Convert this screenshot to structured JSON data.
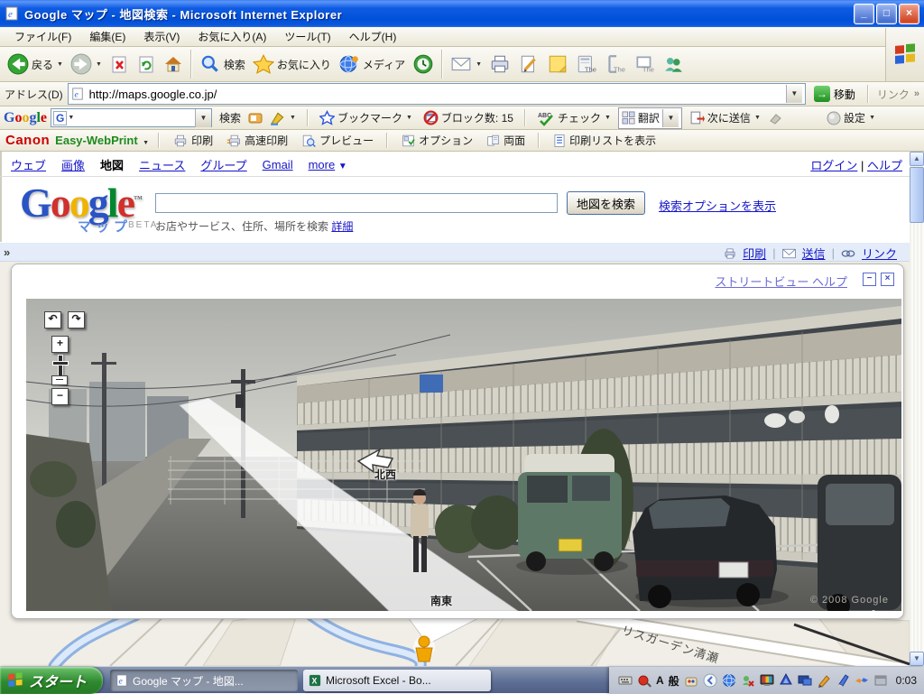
{
  "glyphs": {
    "down": "▼",
    "chevron": "»",
    "sep": "|",
    "tm": "™",
    "min": "_",
    "max": "□",
    "close": "×",
    "back": "←",
    "fwd": "→",
    "plus": "+",
    "minus": "−",
    "rot_l": "↶",
    "rot_r": "↷",
    "panel_min": "−",
    "panel_close": "×",
    "up": "▲",
    "lt": "<",
    "check": "✓",
    "e": "e",
    "x": "X",
    "g": "G"
  },
  "titlebar": {
    "title": "Google マップ - 地図検索 - Microsoft Internet Explorer"
  },
  "menubar": {
    "items": [
      "ファイル(F)",
      "編集(E)",
      "表示(V)",
      "お気に入り(A)",
      "ツール(T)",
      "ヘルプ(H)"
    ]
  },
  "toolbar": {
    "back": "戻る",
    "search": "検索",
    "favorites": "お気に入り",
    "media": "メディア",
    "the": "The"
  },
  "addressbar": {
    "label": "アドレス(D)",
    "url": "http://maps.google.co.jp/",
    "go": "移動",
    "links": "リンク"
  },
  "gtoolbar": {
    "logo_letters": [
      "G",
      "o",
      "o",
      "g",
      "l",
      "e"
    ],
    "search": "検索",
    "bookmarks": "ブックマーク",
    "blocked": "ブロック数: 15",
    "check_abc": "ABC",
    "check": "チェック",
    "translate": "翻訳",
    "send": "次に送信",
    "settings": "設定"
  },
  "canonbar": {
    "brand": "Canon",
    "product": "Easy-WebPrint",
    "print": "印刷",
    "fast_print": "高速印刷",
    "preview": "プレビュー",
    "options": "オプション",
    "duplex": "両面",
    "print_list": "印刷リストを表示"
  },
  "page": {
    "tabs": [
      {
        "label": "ウェブ"
      },
      {
        "label": "画像"
      },
      {
        "label": "地図"
      },
      {
        "label": "ニュース"
      },
      {
        "label": "グループ"
      },
      {
        "label": "Gmail"
      },
      {
        "label": "more"
      }
    ],
    "login": "ログイン",
    "help": "ヘルプ",
    "logo": {
      "letters": [
        "G",
        "o",
        "o",
        "g",
        "l",
        "e"
      ],
      "sub": "マップ",
      "beta": "BETA"
    },
    "search": {
      "value": "",
      "button": "地図を検索",
      "options_link": "検索オプションを表示",
      "hint": "お店やサービス、住所、場所を検索",
      "details_link": "詳細"
    },
    "actionbar": {
      "print": "印刷",
      "send": "送信",
      "link": "リンク"
    }
  },
  "streetview": {
    "help_link": "ストリートビュー ヘルプ",
    "compass_forward": "北西",
    "compass_back": "南東",
    "copyright": "© 2008 Google"
  },
  "map": {
    "street_label": "リスガーデン清瀬"
  },
  "taskbar": {
    "start": "スタート",
    "tasks": [
      {
        "label": "Google マップ - 地図..."
      },
      {
        "label": "Microsoft Excel - Bo..."
      }
    ],
    "tray": {
      "ime_lang": "A",
      "ime_mode": "般",
      "clock": "0:03"
    }
  }
}
